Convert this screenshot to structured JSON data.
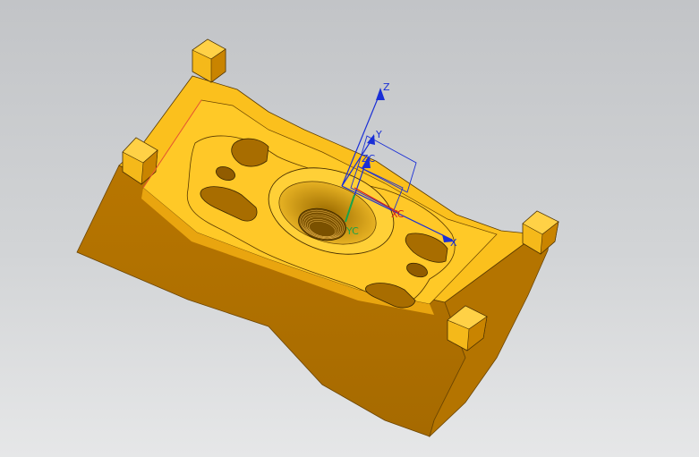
{
  "viewport": {
    "background_top": "#c2c4c7",
    "background_bottom": "#e6e7e8"
  },
  "model": {
    "icon": "machined-fixture-part",
    "color_top": "#fcc21e",
    "color_side": "#b27000",
    "color_dark": "#9b6100",
    "edge_color": "#2a1c00"
  },
  "triad": {
    "wcs": {
      "z": "Z",
      "y": "Y",
      "x": "X",
      "color": "#1a2fd6"
    },
    "mcs": {
      "zc": "ZC",
      "yc": "YC",
      "xc": "XC",
      "color_x": "#d01c1c",
      "color_y": "#1aa34a",
      "color_z": "#1a2fd6"
    }
  }
}
